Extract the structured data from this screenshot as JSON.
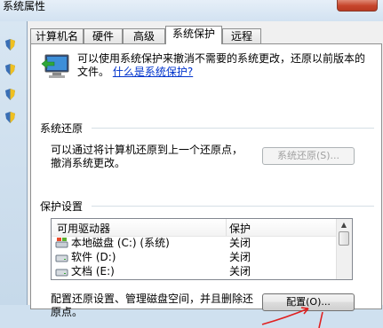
{
  "window": {
    "title": "系统属性"
  },
  "tabs": [
    {
      "label": "计算机名"
    },
    {
      "label": "硬件"
    },
    {
      "label": "高级"
    },
    {
      "label": "系统保护"
    },
    {
      "label": "远程"
    }
  ],
  "intro": {
    "text": "可以使用系统保护来撤消不需要的系统更改，还原以前版本的文件。",
    "link": "什么是系统保护?"
  },
  "system_restore": {
    "title": "系统还原",
    "desc_line1": "可以通过将计算机还原到上一个还原点，",
    "desc_line2": "撤消系统更改。",
    "button": "系统还原(S)..."
  },
  "protection": {
    "title": "保护设置",
    "columns": [
      "可用驱动器",
      "保护"
    ],
    "rows": [
      {
        "name": "本地磁盘 (C:) (系统)",
        "state": "关闭",
        "icon": "system-drive-icon"
      },
      {
        "name": "软件 (D:)",
        "state": "关闭",
        "icon": "drive-icon"
      },
      {
        "name": "文档 (E:)",
        "state": "关闭",
        "icon": "drive-icon"
      }
    ],
    "config_desc_line1": "配置还原设置、管理磁盘空间，并且删除还",
    "config_desc_line2": "原点。",
    "config_button": "配置(O)..."
  }
}
